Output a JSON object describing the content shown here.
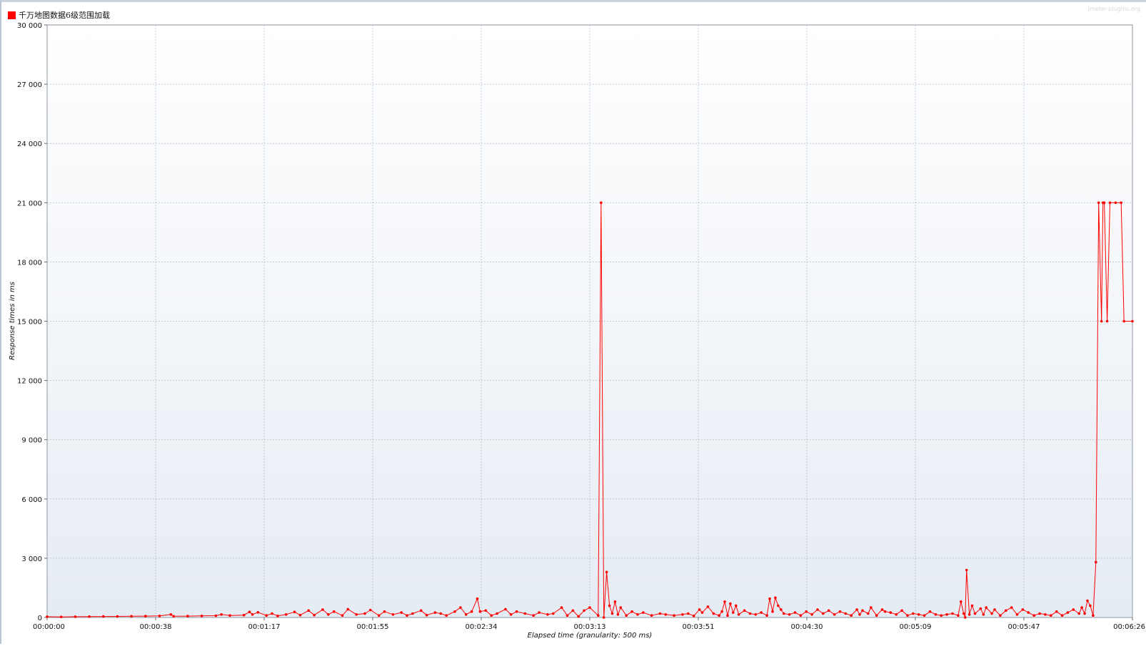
{
  "watermark": "jmeter-plugins.org",
  "chart_data": {
    "type": "line",
    "xlabel": "Elapsed time (granularity: 500 ms)",
    "ylabel": "Response times in ms",
    "ylim": [
      0,
      30000
    ],
    "yticks": [
      "0",
      "3 000",
      "6 000",
      "9 000",
      "12 000",
      "15 000",
      "18 000",
      "21 000",
      "24 000",
      "27 000",
      "30 000"
    ],
    "xlim_seconds": [
      0,
      386
    ],
    "xticks": [
      "00:00:00",
      "00:00:38",
      "00:01:17",
      "00:01:55",
      "00:02:34",
      "00:03:13",
      "00:03:51",
      "00:04:30",
      "00:05:09",
      "00:05:47",
      "00:06:26"
    ],
    "grid": true,
    "legend_position": "top-left",
    "series": [
      {
        "name": "千万地图数据6级范围加载",
        "color": "#ff0000",
        "points": [
          [
            0,
            40
          ],
          [
            5,
            30
          ],
          [
            10,
            40
          ],
          [
            15,
            45
          ],
          [
            20,
            50
          ],
          [
            25,
            55
          ],
          [
            30,
            60
          ],
          [
            35,
            70
          ],
          [
            40,
            80
          ],
          [
            44,
            150
          ],
          [
            45,
            60
          ],
          [
            50,
            70
          ],
          [
            55,
            80
          ],
          [
            60,
            90
          ],
          [
            62,
            150
          ],
          [
            65,
            100
          ],
          [
            70,
            120
          ],
          [
            72,
            280
          ],
          [
            73,
            150
          ],
          [
            75,
            260
          ],
          [
            78,
            100
          ],
          [
            80,
            200
          ],
          [
            82,
            80
          ],
          [
            85,
            150
          ],
          [
            88,
            280
          ],
          [
            90,
            120
          ],
          [
            93,
            350
          ],
          [
            95,
            120
          ],
          [
            98,
            400
          ],
          [
            100,
            150
          ],
          [
            102,
            300
          ],
          [
            105,
            100
          ],
          [
            107,
            420
          ],
          [
            110,
            150
          ],
          [
            113,
            200
          ],
          [
            115,
            380
          ],
          [
            118,
            100
          ],
          [
            120,
            300
          ],
          [
            123,
            150
          ],
          [
            126,
            250
          ],
          [
            128,
            100
          ],
          [
            130,
            200
          ],
          [
            133,
            350
          ],
          [
            135,
            120
          ],
          [
            138,
            250
          ],
          [
            140,
            200
          ],
          [
            142,
            100
          ],
          [
            145,
            300
          ],
          [
            147,
            500
          ],
          [
            149,
            150
          ],
          [
            151,
            300
          ],
          [
            153,
            950
          ],
          [
            154,
            300
          ],
          [
            156,
            350
          ],
          [
            158,
            100
          ],
          [
            160,
            200
          ],
          [
            163,
            420
          ],
          [
            165,
            150
          ],
          [
            167,
            300
          ],
          [
            170,
            200
          ],
          [
            173,
            100
          ],
          [
            175,
            250
          ],
          [
            178,
            150
          ],
          [
            180,
            200
          ],
          [
            183,
            500
          ],
          [
            185,
            100
          ],
          [
            187,
            350
          ],
          [
            189,
            50
          ],
          [
            191,
            350
          ],
          [
            193,
            500
          ],
          [
            196,
            100
          ],
          [
            197,
            21000
          ],
          [
            198,
            0
          ],
          [
            199,
            2300
          ],
          [
            200,
            600
          ],
          [
            201,
            200
          ],
          [
            202,
            800
          ],
          [
            203,
            150
          ],
          [
            204,
            500
          ],
          [
            206,
            100
          ],
          [
            208,
            300
          ],
          [
            210,
            150
          ],
          [
            212,
            250
          ],
          [
            215,
            100
          ],
          [
            218,
            200
          ],
          [
            220,
            150
          ],
          [
            223,
            100
          ],
          [
            226,
            150
          ],
          [
            228,
            200
          ],
          [
            230,
            80
          ],
          [
            232,
            400
          ],
          [
            233,
            250
          ],
          [
            235,
            550
          ],
          [
            237,
            200
          ],
          [
            239,
            100
          ],
          [
            240,
            300
          ],
          [
            241,
            800
          ],
          [
            242,
            100
          ],
          [
            243,
            700
          ],
          [
            244,
            250
          ],
          [
            245,
            600
          ],
          [
            246,
            150
          ],
          [
            248,
            350
          ],
          [
            250,
            200
          ],
          [
            252,
            150
          ],
          [
            254,
            250
          ],
          [
            256,
            100
          ],
          [
            257,
            950
          ],
          [
            258,
            300
          ],
          [
            259,
            1000
          ],
          [
            260,
            600
          ],
          [
            261,
            400
          ],
          [
            262,
            200
          ],
          [
            264,
            150
          ],
          [
            266,
            250
          ],
          [
            268,
            100
          ],
          [
            270,
            300
          ],
          [
            272,
            150
          ],
          [
            274,
            400
          ],
          [
            276,
            200
          ],
          [
            278,
            350
          ],
          [
            280,
            150
          ],
          [
            282,
            300
          ],
          [
            284,
            200
          ],
          [
            286,
            100
          ],
          [
            288,
            400
          ],
          [
            289,
            150
          ],
          [
            290,
            350
          ],
          [
            292,
            200
          ],
          [
            293,
            500
          ],
          [
            295,
            100
          ],
          [
            297,
            400
          ],
          [
            298,
            300
          ],
          [
            300,
            250
          ],
          [
            302,
            150
          ],
          [
            304,
            350
          ],
          [
            306,
            100
          ],
          [
            308,
            200
          ],
          [
            310,
            150
          ],
          [
            312,
            100
          ],
          [
            314,
            300
          ],
          [
            316,
            150
          ],
          [
            318,
            100
          ],
          [
            320,
            150
          ],
          [
            322,
            200
          ],
          [
            324,
            100
          ],
          [
            325,
            800
          ],
          [
            326,
            200
          ],
          [
            326.5,
            0
          ],
          [
            327,
            2400
          ],
          [
            328,
            150
          ],
          [
            329,
            600
          ],
          [
            330,
            200
          ],
          [
            332,
            450
          ],
          [
            333,
            150
          ],
          [
            334,
            500
          ],
          [
            336,
            200
          ],
          [
            337,
            400
          ],
          [
            339,
            100
          ],
          [
            341,
            350
          ],
          [
            343,
            500
          ],
          [
            345,
            150
          ],
          [
            347,
            400
          ],
          [
            349,
            250
          ],
          [
            351,
            100
          ],
          [
            353,
            200
          ],
          [
            355,
            150
          ],
          [
            357,
            100
          ],
          [
            359,
            300
          ],
          [
            361,
            100
          ],
          [
            363,
            250
          ],
          [
            365,
            400
          ],
          [
            367,
            200
          ],
          [
            368,
            500
          ],
          [
            369,
            200
          ],
          [
            370,
            850
          ],
          [
            371,
            600
          ],
          [
            372,
            100
          ],
          [
            373,
            2800
          ],
          [
            374,
            21000
          ],
          [
            375,
            15000
          ],
          [
            375.5,
            21000
          ],
          [
            376,
            21000
          ],
          [
            377,
            15000
          ],
          [
            378,
            21000
          ],
          [
            380,
            21000
          ],
          [
            382,
            21000
          ],
          [
            383,
            15000
          ],
          [
            386,
            15000
          ]
        ]
      }
    ]
  }
}
